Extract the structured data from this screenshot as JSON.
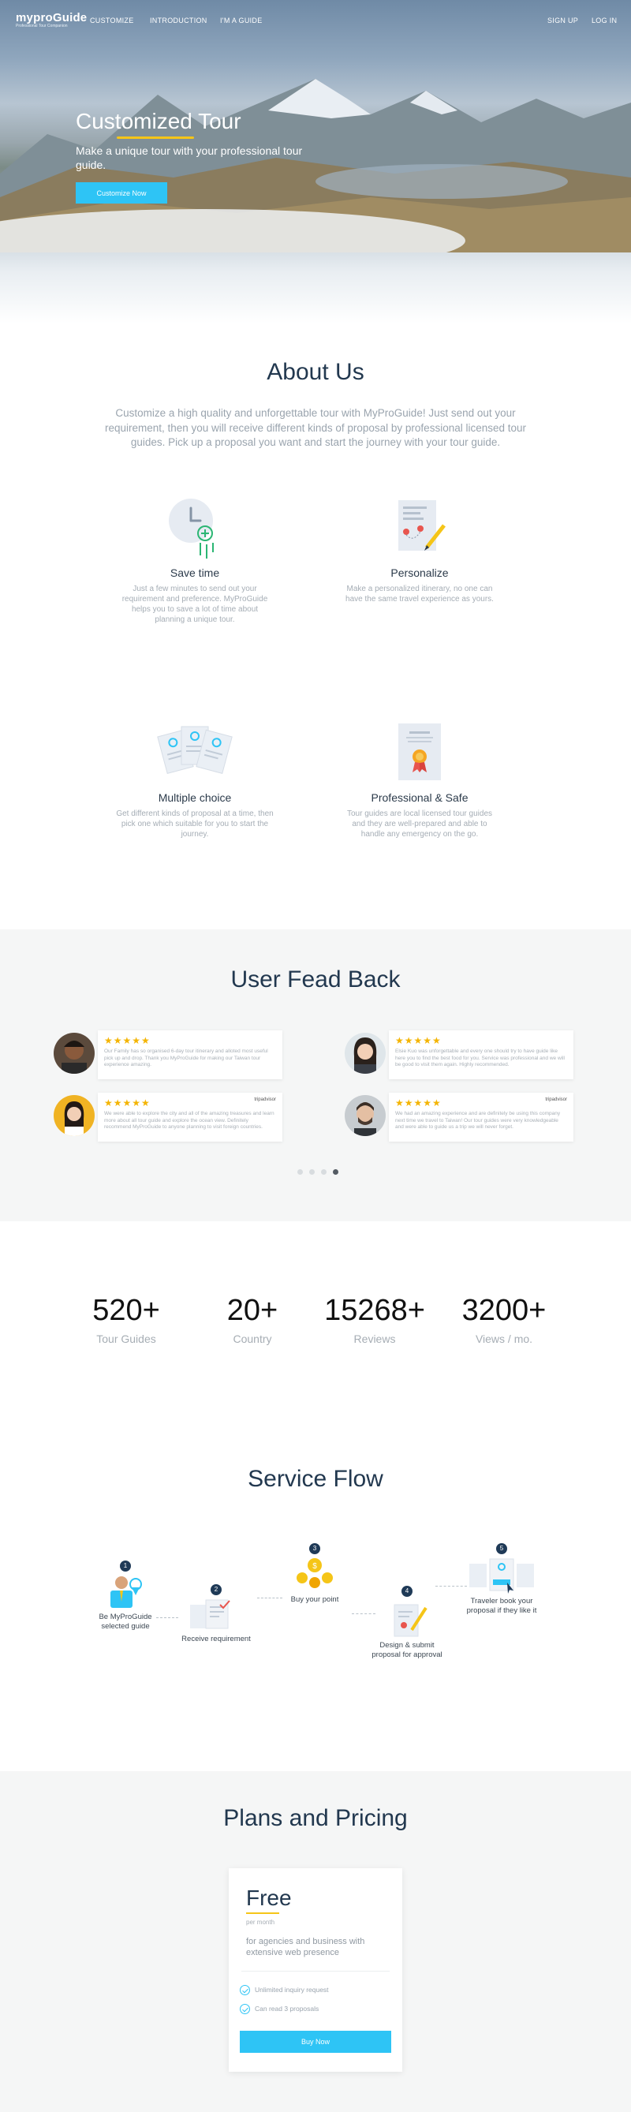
{
  "nav": {
    "logo": "myproGuide",
    "logo_tagline": "Professional Tour Companion",
    "links": [
      "CUSTOMIZE",
      "INTRODUCTION",
      "I'M A GUIDE"
    ],
    "signup": "SIGN UP",
    "login": "LOG IN"
  },
  "hero": {
    "title": "Customized Tour",
    "subtitle": "Make a unique tour with your professional tour guide.",
    "cta": "Customize Now"
  },
  "about": {
    "title": "About Us",
    "description": "Customize a high quality and unforgettable tour with MyProGuide! Just send out your requirement, then you will receive different kinds of proposal by professional licensed tour guides. Pick up a proposal you want and start the journey with your tour guide.",
    "features": [
      {
        "title": "Save time",
        "text": "Just a few minutes to send out your requirement and preference. MyProGuide helps you to save a lot of time about planning a unique tour.",
        "icon": "clock-icon"
      },
      {
        "title": "Personalize",
        "text": "Make a personalized itinerary, no one can have the same travel experience as yours.",
        "icon": "map-pencil-icon"
      },
      {
        "title": "Multiple choice",
        "text": "Get different kinds of proposal at a time, then pick one which suitable for you to start the journey.",
        "icon": "proposals-icon"
      },
      {
        "title": "Professional & Safe",
        "text": "Tour guides are local licensed tour guides and they are well-prepared and able to handle any emergency on the go.",
        "icon": "certificate-icon"
      }
    ]
  },
  "feedback": {
    "title": "User Fead Back",
    "reviews": [
      {
        "stars": "★★★★★",
        "text": "Our Family has so organised 6-day tour itinerary and alloted most useful pick up and drop. Thank you MyProGuide for making our Taiwan tour experience amazing."
      },
      {
        "stars": "★★★★★",
        "text": "Elsie Kuo was unforgettable and every one should try to have guide like here you to find the best food for you. Service was professional and we will be good to visit them again. Highly recommended."
      },
      {
        "stars": "★★★★★",
        "text": "We were able to explore the city and all of the amazing treasures and learn more about all tour guide and explore the ocean view. Definitely recommend MyProGuide to anyone planning to visit foreign countries.",
        "badge": "tripadvisor"
      },
      {
        "stars": "★★★★★",
        "text": "We had an amazing experience and are definitely be using this company next time we travel to Taiwan! Our tour guides were very knowledgeable and were able to guide us a trip we will never forget.",
        "badge": "tripadvisor"
      }
    ]
  },
  "stats": [
    {
      "num": "520+",
      "label": "Tour Guides"
    },
    {
      "num": "20+",
      "label": "Country"
    },
    {
      "num": "15268+",
      "label": "Reviews"
    },
    {
      "num": "3200+",
      "label": "Views / mo."
    }
  ],
  "flow": {
    "title": "Service Flow",
    "steps": [
      {
        "n": "1",
        "label": "Be MyProGuide selected guide"
      },
      {
        "n": "2",
        "label": "Receive requirement"
      },
      {
        "n": "3",
        "label": "Buy your point"
      },
      {
        "n": "4",
        "label": "Design & submit proposal for approval"
      },
      {
        "n": "5",
        "label": "Traveler book your proposal if they like it"
      }
    ]
  },
  "pricing": {
    "title": "Plans and Pricing",
    "plan": "Free",
    "period": "per month",
    "description": "for agencies and business with extensive  web presence",
    "features": [
      "Unlimited inquiry request",
      "Can read 3 proposals"
    ],
    "cta": "Buy Now"
  },
  "colors": {
    "accent": "#2ec4f5",
    "heading": "#22384f",
    "highlight": "#f5c518"
  }
}
